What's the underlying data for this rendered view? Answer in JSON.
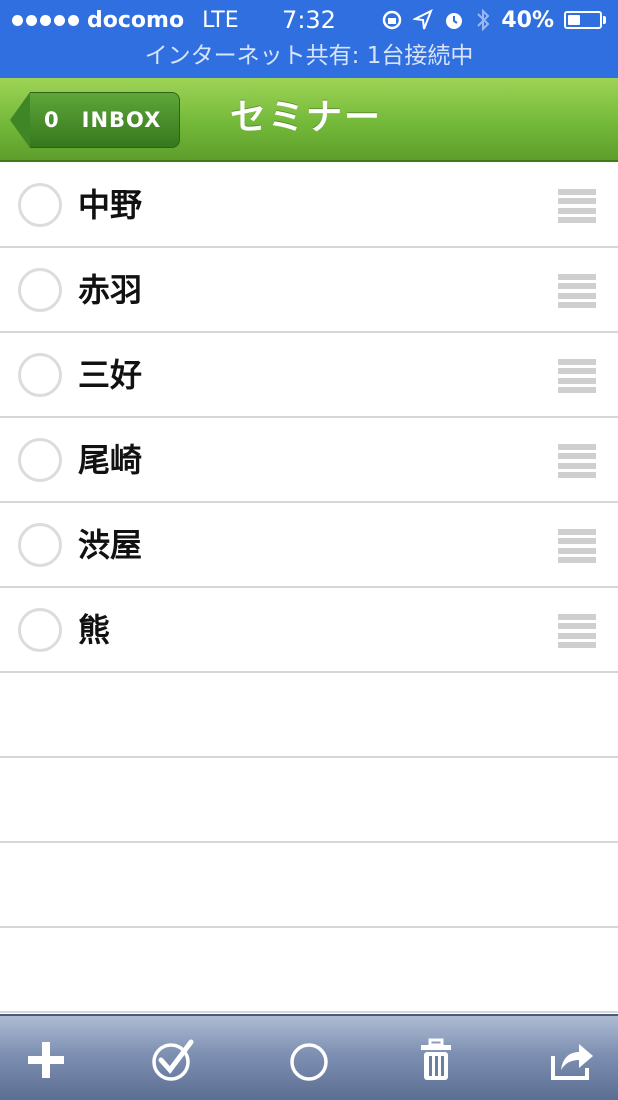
{
  "status_bar": {
    "carrier": "docomo",
    "network": "LTE",
    "time": "7:32",
    "battery_text": "40%",
    "battery_level": 0.4,
    "hotspot_text": "インターネット共有: 1台接続中",
    "icons": [
      "signal-dots",
      "rotation-lock-icon",
      "location-icon",
      "alarm-icon",
      "bluetooth-icon",
      "battery-icon"
    ]
  },
  "nav": {
    "back_count": "0",
    "back_label": "INBOX",
    "title": "セミナー"
  },
  "list": {
    "items": [
      {
        "label": "中野"
      },
      {
        "label": "赤羽"
      },
      {
        "label": "三好"
      },
      {
        "label": "尾崎"
      },
      {
        "label": "渋屋"
      },
      {
        "label": "熊"
      }
    ],
    "empty_rows": 4
  },
  "toolbar": {
    "icons": [
      "add-icon",
      "check-circle-icon",
      "circle-icon",
      "trash-icon",
      "share-icon"
    ]
  },
  "colors": {
    "status_bar": "#2f6fe0",
    "nav_green": "#74b93a",
    "toolbar_blue": "#7e90b2"
  }
}
